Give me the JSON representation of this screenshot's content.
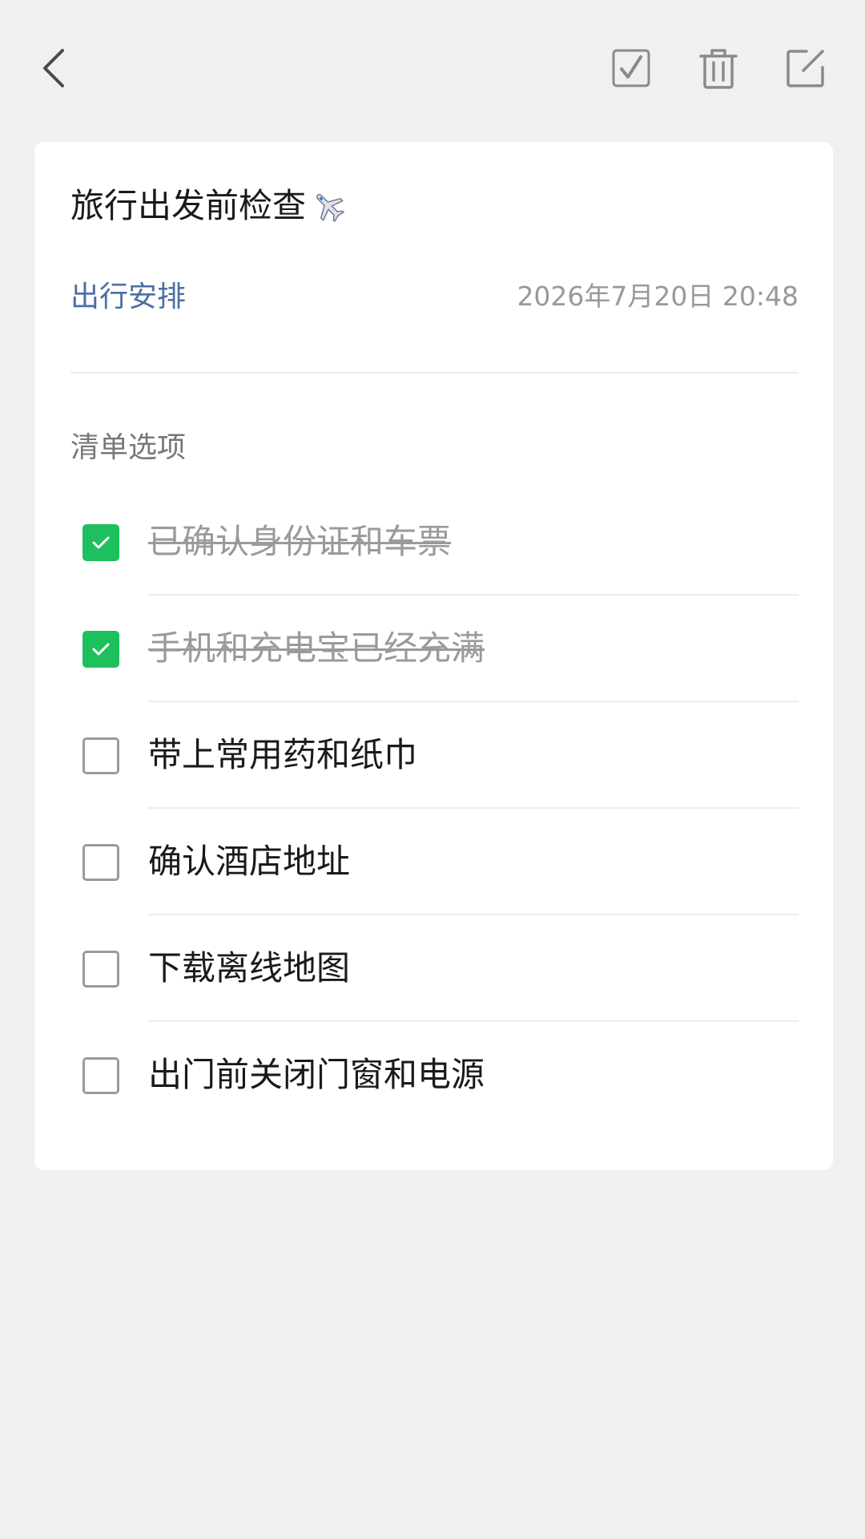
{
  "header": {
    "back_icon": "chevron-left-icon",
    "actions": [
      {
        "icon": "checkbox-checked-icon"
      },
      {
        "icon": "trash-icon"
      },
      {
        "icon": "edit-icon"
      }
    ]
  },
  "note": {
    "title": "旅行出发前检查",
    "title_icon": "airplane-icon",
    "category": "出行安排",
    "datetime": "2026年7月20日 20:48",
    "section_label": "清单选项",
    "items": [
      {
        "text": "已确认身份证和车票",
        "checked": true
      },
      {
        "text": "手机和充电宝已经充满",
        "checked": true
      },
      {
        "text": "带上常用药和纸巾",
        "checked": false
      },
      {
        "text": "确认酒店地址",
        "checked": false
      },
      {
        "text": "下载离线地图",
        "checked": false
      },
      {
        "text": "出门前关闭门窗和电源",
        "checked": false
      }
    ]
  },
  "colors": {
    "background": "#f0f0f0",
    "card": "#ffffff",
    "accent_green": "#1ec05e",
    "category_blue": "#4a6fa5",
    "muted_text": "#999999"
  }
}
